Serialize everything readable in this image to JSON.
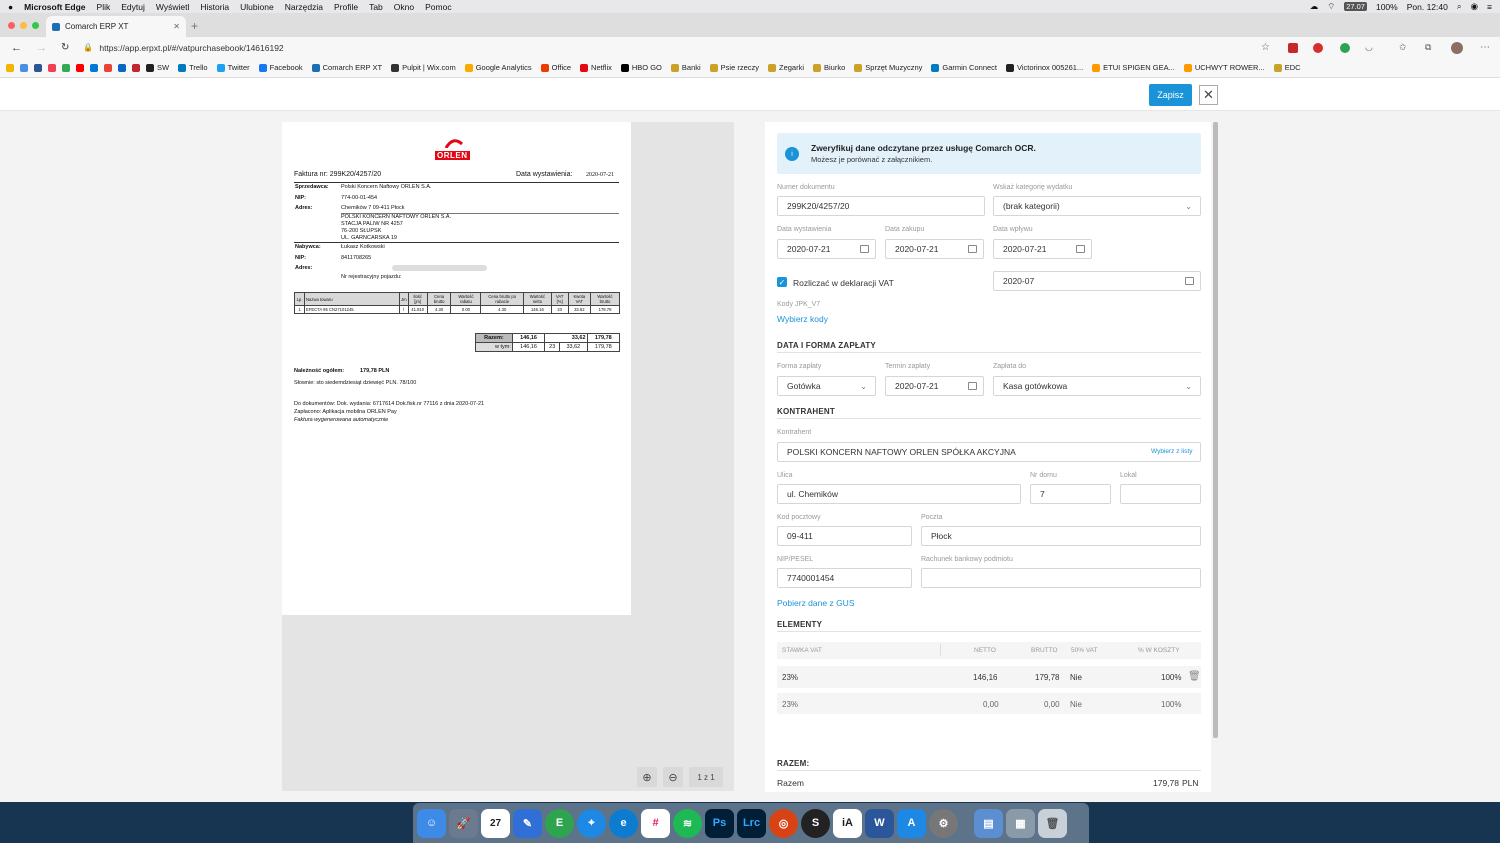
{
  "menubar": {
    "items": [
      "Microsoft Edge",
      "Plik",
      "Edytuj",
      "Wyświetl",
      "Historia",
      "Ulubione",
      "Narzędzia",
      "Profile",
      "Tab",
      "Okno",
      "Pomoc"
    ],
    "date": "27.07",
    "battery": "100%",
    "clock": "Pon. 12:40"
  },
  "browser": {
    "tab_title": "Comarch ERP XT",
    "url": "https://app.erpxt.pl/#/vatpurchasebook/14616192",
    "favorites": [
      "SW",
      "Trello",
      "Twitter",
      "Facebook",
      "Comarch ERP XT",
      "Pulpit | Wix.com",
      "Google Analytics",
      "Office",
      "Netflix",
      "HBO GO",
      "Banki",
      "Psie rzeczy",
      "Zegarki",
      "Biurko",
      "Sprzęt Muzyczny",
      "Garmin Connect",
      "Victorinox 005261...",
      "ETUI SPIGEN GEA...",
      "UCHWYT ROWER...",
      "EDC"
    ]
  },
  "header": {
    "save_label": "Zapisz"
  },
  "invoice": {
    "logo": "ORLEN",
    "number_label": "Faktura nr: 299K20/4257/20",
    "date_label": "Data wystawienia:",
    "date": "2020-07-21",
    "seller_label": "Sprzedawca:",
    "seller": "Polski Koncern Naftowy ORLEN S.A.",
    "nip_label": "NIP:",
    "seller_nip": "774-00-01-454",
    "addr_label": "Adres:",
    "seller_addr": "Chemików 7 09-411 Płock",
    "station_lines": [
      "POLSKI KONCERN NAFTOWY ORLEN S.A.",
      "STACJA PALIW NR 4257",
      "76-200 SŁUPSK",
      "UL. GARNCARSKA 19"
    ],
    "buyer_label": "Nabywca:",
    "buyer": "Łukasz Kotkowski",
    "buyer_nip": "8411708265",
    "reg_label": "Nr rejestracyjny pojazdu:",
    "table_headers": [
      "Lp.",
      "Nazwa towaru",
      "Jm",
      "Ilość [jm]",
      "Cena brutto",
      "Wartość rabatu",
      "Cena brutto po rabacie",
      "Wartość netto",
      "VAT [%]",
      "Kwota VAT",
      "Wartość brutto"
    ],
    "table_row": [
      "1",
      "EFECTA 95 CN27101245",
      "l",
      "41.810",
      "4.30",
      "0.00",
      "4.30",
      "146.16",
      "23",
      "33.62",
      "179.78"
    ],
    "sum_label": "Razem:",
    "sum_net": "146,16",
    "sum_vat": "33,62",
    "sum_gross": "179,78",
    "incl_label": "w tym:",
    "incl_net": "146,16",
    "incl_rate": "23",
    "incl_vat": "33,62",
    "incl_gross": "179,78",
    "total_label": "Należność ogółem:",
    "total": "179,78 PLN",
    "words": "Słownie:   sto siedemdziesiąt dziewięć PLN. 78/100",
    "doc_line": "Do dokumentów:   Dok. wydania: 6717614 Dok.fisk.nr 77116 z dnia 2020-07-21",
    "paid_line": "Zapłacono:    Aplikacja mobilna ORLEN Pay",
    "auto_line": "Faktura wygenerowana automatycznie"
  },
  "preview": {
    "pages": "1 z 1"
  },
  "form": {
    "info_title": "Zweryfikuj dane odczytane przez usługę Comarch OCR.",
    "info_sub": "Możesz je porównać z załącznikiem.",
    "doc_no_label": "Numer dokumentu",
    "doc_no": "299K20/4257/20",
    "category_label": "Wskaż kategorię wydatku",
    "category": "(brak kategorii)",
    "issue_label": "Data wystawienia",
    "issue": "2020-07-21",
    "purchase_label": "Data zakupu",
    "purchase": "2020-07-21",
    "receipt_label": "Data wpływu",
    "receipt": "2020-07-21",
    "vat_check_label": "Rozliczać w deklaracji VAT",
    "vat_period": "2020-07",
    "jpk_label": "Kody JPK_V7",
    "jpk_link": "Wybierz kody",
    "pay_section": "DATA I FORMA ZAPŁATY",
    "pay_form_label": "Forma zapłaty",
    "pay_form": "Gotówka",
    "due_label": "Termin zapłaty",
    "due": "2020-07-21",
    "pay_to_label": "Zapłata do",
    "pay_to": "Kasa gotówkowa",
    "contractor_section": "KONTRAHENT",
    "contractor_label": "Kontrahent",
    "contractor": "POLSKI KONCERN NAFTOWY ORLEN SPÓŁKA AKCYJNA",
    "pick_list": "Wybierz z listy",
    "street_label": "Ulica",
    "street": "ul. Chemików",
    "house_label": "Nr domu",
    "house": "7",
    "flat_label": "Lokal",
    "flat": "",
    "zip_label": "Kod pocztowy",
    "zip": "09-411",
    "post_label": "Poczta",
    "post": "Płock",
    "nip_label": "NIP/PESEL",
    "nip": "7740001454",
    "bank_label": "Rachunek bankowy podmiotu",
    "bank": "",
    "gus_link": "Pobierz dane z GUS",
    "elements_section": "ELEMENTY",
    "el_headers": [
      "STAWKA VAT",
      "NETTO",
      "BRUTTO",
      "50% VAT",
      "% W KOSZTY"
    ],
    "el_rows": [
      [
        "23%",
        "146,16",
        "179,78",
        "Nie",
        "100%"
      ],
      [
        "23%",
        "0,00",
        "0,00",
        "Nie",
        "100%"
      ]
    ],
    "total_section": "RAZEM:",
    "total_label": "Razem",
    "total": "179,78",
    "currency": "PLN"
  },
  "colors": {
    "accent": "#1a93d9",
    "info_bg": "#e3f2fa"
  }
}
